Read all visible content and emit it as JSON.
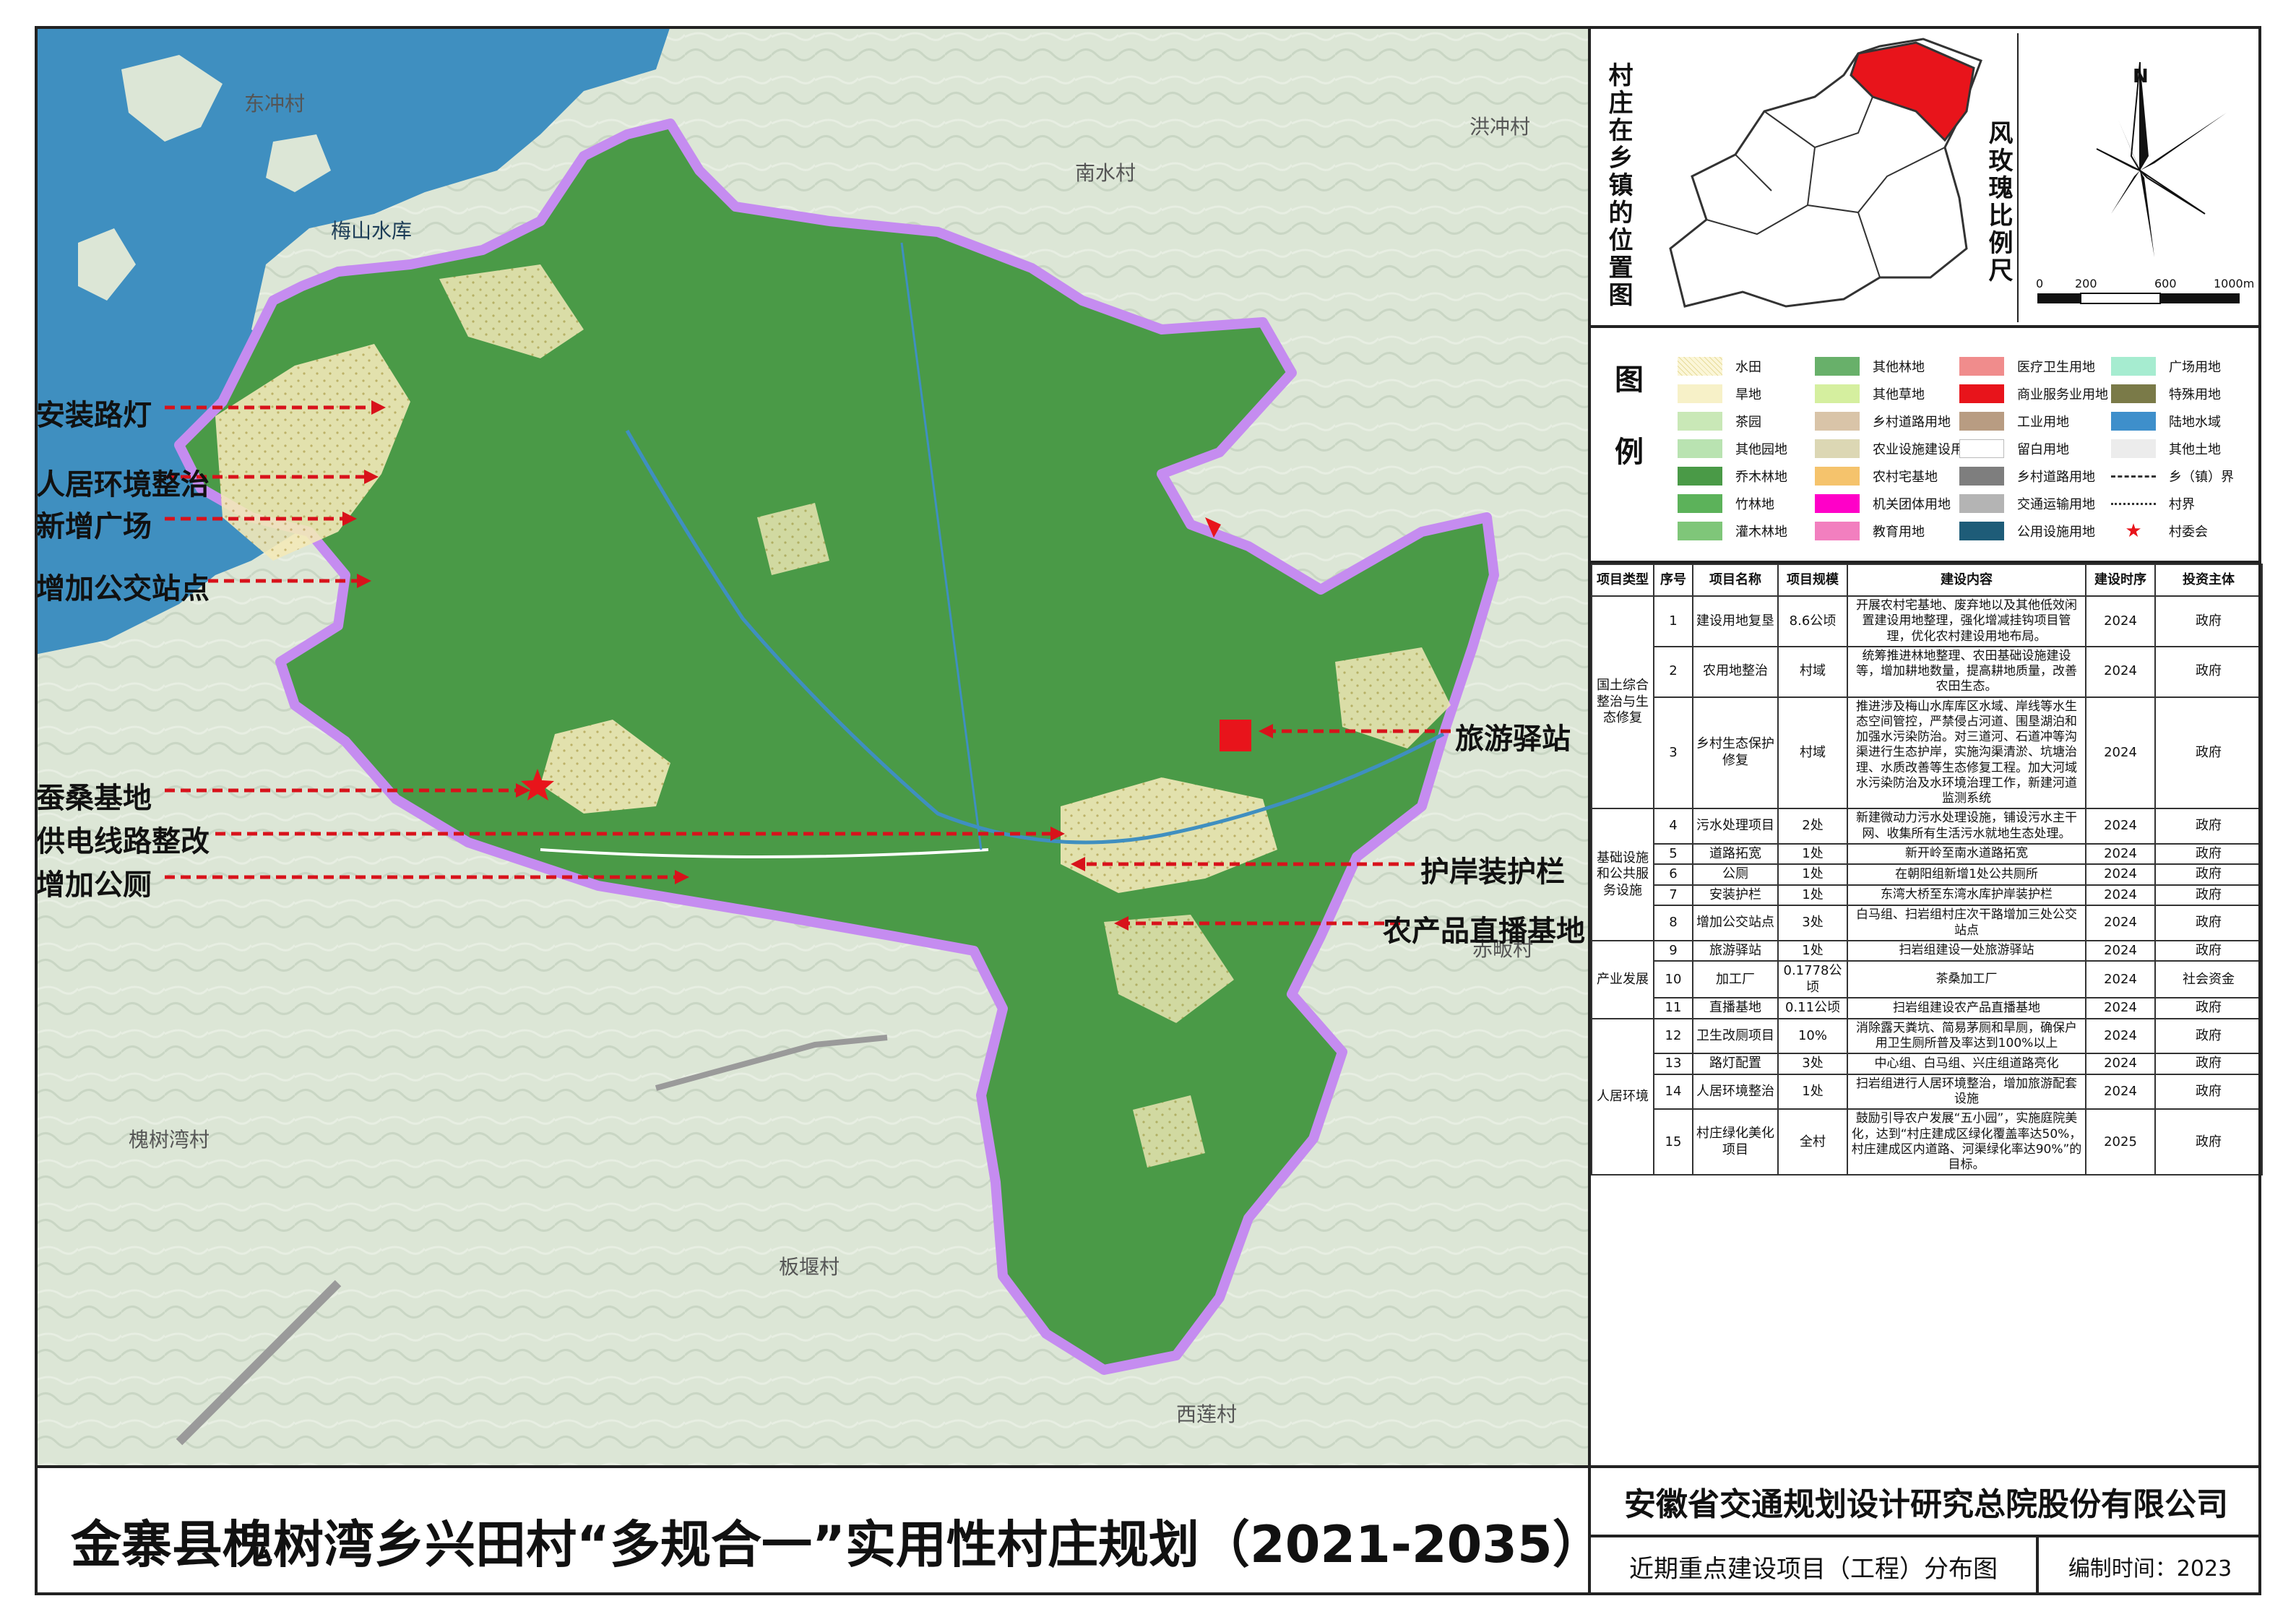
{
  "title": "金寨县槐树湾乡兴田村“多规合一”实用性村庄规划（2021-2035）",
  "company": "安徽省交通规划设计研究总院股份有限公司",
  "subtitle": "近期重点建设项目（工程）分布图",
  "date": "编制时间：2023",
  "colors": {
    "water": "#3f8fc0",
    "forest": "#4a9a47",
    "boundary": "#c58cf0",
    "arrow": "#d8121b",
    "village_land": "#f3d9a0"
  },
  "map": {
    "villages": [
      "东冲村",
      "南水村",
      "洪冲村",
      "梅山水库",
      "赤畈村",
      "槐树湾村",
      "板堰村",
      "西莲村"
    ],
    "annotations_left": [
      "安装路灯",
      "人居环境整治",
      "新增广场",
      "增加公交站点",
      "蚕桑基地",
      "供电线路整改",
      "增加公厕"
    ],
    "annotations_right": [
      "旅游驿站",
      "护岸装护栏",
      "农产品直播基地"
    ]
  },
  "location": {
    "label": "村庄在乡镇的位置图",
    "rose_label": "风玫瑰比例尺",
    "north": "N",
    "scale_ticks": [
      "0",
      "200",
      "600",
      "1000m"
    ]
  },
  "legend": {
    "label": "图例",
    "items": [
      {
        "label": "水田",
        "color": "#fbf6d8",
        "icon": "paddy"
      },
      {
        "label": "旱地",
        "color": "#f7f1c8",
        "icon": "dry"
      },
      {
        "label": "茶园",
        "color": "#c9e8b7",
        "icon": "fill"
      },
      {
        "label": "其他园地",
        "color": "#b9e3b1",
        "icon": "fill"
      },
      {
        "label": "乔木林地",
        "color": "#4a9a47",
        "icon": "fill"
      },
      {
        "label": "竹林地",
        "color": "#5cb25a",
        "icon": "fill"
      },
      {
        "label": "灌木林地",
        "color": "#7fc679",
        "icon": "fill"
      },
      {
        "label": "其他林地",
        "color": "#68b06a",
        "icon": "fill"
      },
      {
        "label": "其他草地",
        "color": "#d5ef9f",
        "icon": "fill"
      },
      {
        "label": "乡村道路用地",
        "color": "#d9c4a8",
        "icon": "fill"
      },
      {
        "label": "农业设施建设用地",
        "color": "#dcd7b4",
        "icon": "fill"
      },
      {
        "label": "农村宅基地",
        "color": "#f5c36c",
        "icon": "fill"
      },
      {
        "label": "机关团体用地",
        "color": "#ff00c8",
        "icon": "fill"
      },
      {
        "label": "教育用地",
        "color": "#f27fbf",
        "icon": "fill"
      },
      {
        "label": "医疗卫生用地",
        "color": "#f08c8c",
        "icon": "fill"
      },
      {
        "label": "商业服务业用地",
        "color": "#e8141b",
        "icon": "fill"
      },
      {
        "label": "工业用地",
        "color": "#b89c82",
        "icon": "fill"
      },
      {
        "label": "留白用地",
        "color": "#ffffff",
        "icon": "fill"
      },
      {
        "label": "乡村道路用地",
        "color": "#7e7e7e",
        "icon": "fill"
      },
      {
        "label": "交通运输用地",
        "color": "#b4b4b4",
        "icon": "fill"
      },
      {
        "label": "公用设施用地",
        "color": "#1e5c78",
        "icon": "fill"
      },
      {
        "label": "广场用地",
        "color": "#a6ecd0",
        "icon": "fill"
      },
      {
        "label": "特殊用地",
        "color": "#7a7a48",
        "icon": "fill"
      },
      {
        "label": "陆地水域",
        "color": "#3e8fcb",
        "icon": "fill"
      },
      {
        "label": "其他土地",
        "color": "#ececec",
        "icon": "fill"
      },
      {
        "label": "乡（镇）界",
        "color": "#333333",
        "icon": "dash"
      },
      {
        "label": "村界",
        "color": "#333333",
        "icon": "dot"
      },
      {
        "label": "村委会",
        "color": "#e8141b",
        "icon": "star"
      }
    ]
  },
  "table": {
    "headers": [
      "项目类型",
      "序号",
      "项目名称",
      "项目规模",
      "建设内容",
      "建设时序",
      "投资主体"
    ],
    "groups": [
      {
        "type": "国土综合整治与生态修复",
        "rows": [
          {
            "no": "1",
            "name": "建设用地复垦",
            "scale": "8.6公顷",
            "content": "开展农村宅基地、废弃地以及其他低效闲置建设用地整理，强化增减挂钩项目管理，优化农村建设用地布局。",
            "year": "2024",
            "investor": "政府"
          },
          {
            "no": "2",
            "name": "农用地整治",
            "scale": "村域",
            "content": "统筹推进林地整理、农田基础设施建设等，增加耕地数量，提高耕地质量，改善农田生态。",
            "year": "2024",
            "investor": "政府"
          },
          {
            "no": "3",
            "name": "乡村生态保护修复",
            "scale": "村域",
            "content": "推进涉及梅山水库库区水域、岸线等水生态空间管控，严禁侵占河道、围垦湖泊和加强水污染防治。对三道河、石道冲等沟渠进行生态护岸，实施沟渠清淤、坑塘治理、水质改善等生态修复工程。加大河域水污染防治及水环境治理工作，新建河道监测系统",
            "year": "2024",
            "investor": "政府"
          }
        ]
      },
      {
        "type": "基础设施和公共服务设施",
        "rows": [
          {
            "no": "4",
            "name": "污水处理项目",
            "scale": "2处",
            "content": "新建微动力污水处理设施，铺设污水主干网、收集所有生活污水就地生态处理。",
            "year": "2024",
            "investor": "政府"
          },
          {
            "no": "5",
            "name": "道路拓宽",
            "scale": "1处",
            "content": "新开岭至南水道路拓宽",
            "year": "2024",
            "investor": "政府"
          },
          {
            "no": "6",
            "name": "公厕",
            "scale": "1处",
            "content": "在朝阳组新增1处公共厕所",
            "year": "2024",
            "investor": "政府"
          },
          {
            "no": "7",
            "name": "安装护栏",
            "scale": "1处",
            "content": "东湾大桥至东湾水库护岸装护栏",
            "year": "2024",
            "investor": "政府"
          },
          {
            "no": "8",
            "name": "增加公交站点",
            "scale": "3处",
            "content": "白马组、扫岩组村庄次干路增加三处公交站点",
            "year": "2024",
            "investor": "政府"
          }
        ]
      },
      {
        "type": "产业发展",
        "rows": [
          {
            "no": "9",
            "name": "旅游驿站",
            "scale": "1处",
            "content": "扫岩组建设一处旅游驿站",
            "year": "2024",
            "investor": "政府"
          },
          {
            "no": "10",
            "name": "加工厂",
            "scale": "0.1778公顷",
            "content": "茶桑加工厂",
            "year": "2024",
            "investor": "社会资金"
          },
          {
            "no": "11",
            "name": "直播基地",
            "scale": "0.11公顷",
            "content": "扫岩组建设农产品直播基地",
            "year": "2024",
            "investor": "政府"
          }
        ]
      },
      {
        "type": "人居环境",
        "rows": [
          {
            "no": "12",
            "name": "卫生改厕项目",
            "scale": "10%",
            "content": "消除露天粪坑、简易茅厕和旱厕，确保户用卫生厕所普及率达到100%以上",
            "year": "2024",
            "investor": "政府"
          },
          {
            "no": "13",
            "name": "路灯配置",
            "scale": "3处",
            "content": "中心组、白马组、兴庄组道路亮化",
            "year": "2024",
            "investor": "政府"
          },
          {
            "no": "14",
            "name": "人居环境整治",
            "scale": "1处",
            "content": "扫岩组进行人居环境整治，增加旅游配套设施",
            "year": "2024",
            "investor": "政府"
          },
          {
            "no": "15",
            "name": "村庄绿化美化项目",
            "scale": "全村",
            "content": "鼓励引导农户发展“五小园”，实施庭院美化，达到“村庄建成区绿化覆盖率达50%，村庄建成区内道路、河渠绿化率达90%”的目标。",
            "year": "2025",
            "investor": "政府"
          }
        ]
      }
    ]
  }
}
